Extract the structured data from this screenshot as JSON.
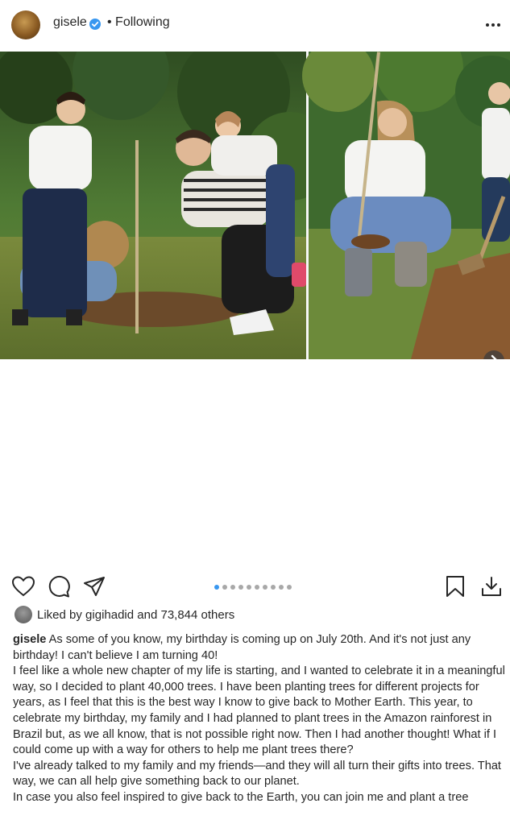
{
  "header": {
    "username": "gisele",
    "following_label": "• Following"
  },
  "carousel": {
    "total_slides": 10,
    "current_slide": 1
  },
  "likes": {
    "prefix": "Liked by ",
    "user": "gigihadid",
    "middle": " and ",
    "count": "73,844 others"
  },
  "caption": {
    "username": "gisele",
    "first_line": " As some of you know, my birthday is coming up on July 20th. And it's not just any birthday! I can't believe I am turning 40!",
    "paragraphs": [
      "I feel like a whole new chapter of my life is starting, and I wanted to celebrate it in a meaningful way, so I decided to plant 40,000 trees. I have been planting trees for different projects for years, as I feel that this is the best way I know to give back to Mother Earth. This year, to celebrate my birthday, my family and I had planned to plant trees in the Amazon rainforest in Brazil but, as we all know, that is not possible right now. Then I had another thought! What if I could come up with a way for others to help me plant trees there?",
      "I've already talked to my family and my friends—and they will all turn their gifts into trees. That way, we can all help give something back to our planet.",
      "In case you also feel inspired to give back to the Earth, you can join me and plant a tree"
    ]
  }
}
